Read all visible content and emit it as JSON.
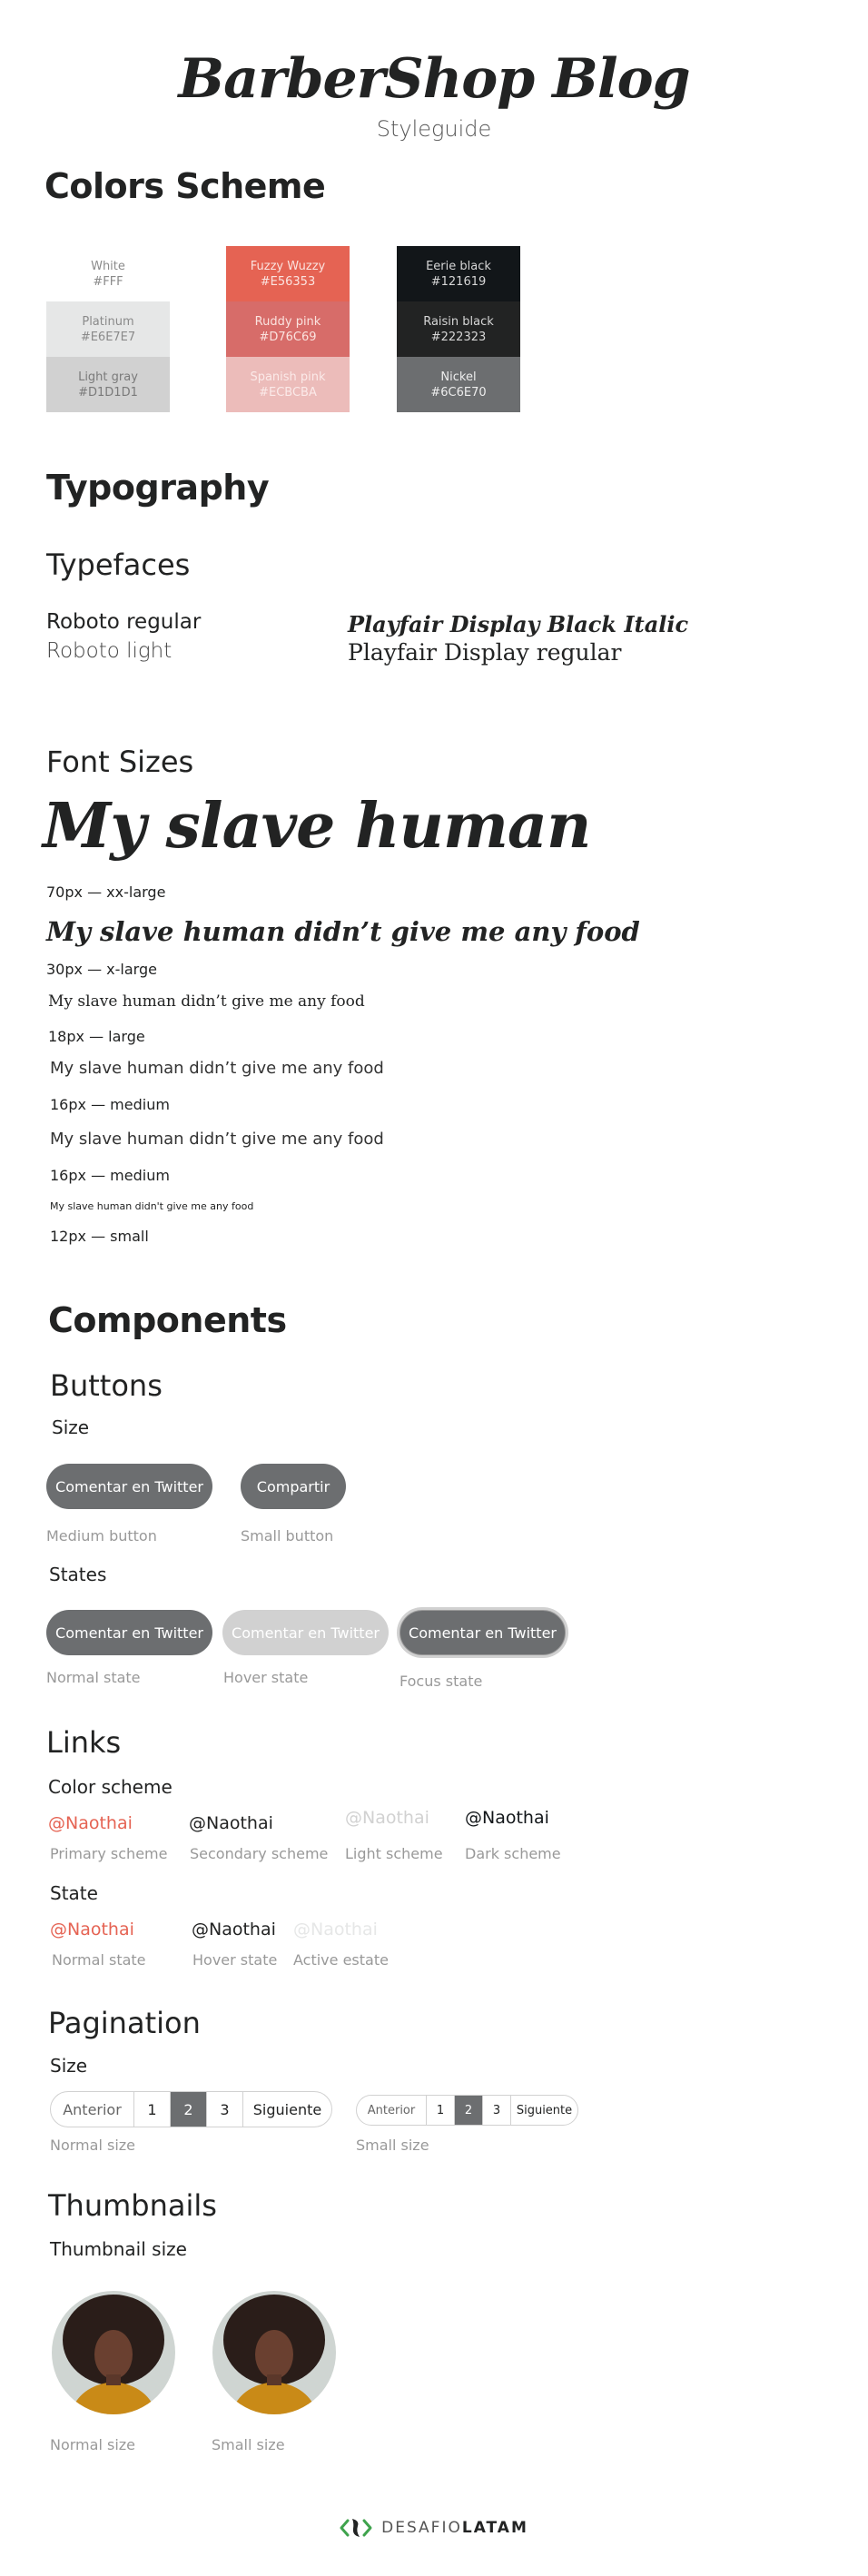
{
  "header": {
    "title": "BarberShop Blog",
    "subtitle": "Styleguide"
  },
  "colors": {
    "heading": "Colors Scheme",
    "columns": [
      [
        {
          "name": "White",
          "hex": "#FFF",
          "bg": "#ffffff",
          "fg": "#8a8a8a"
        },
        {
          "name": "Platinum",
          "hex": "#E6E7E7",
          "bg": "#e6e7e7",
          "fg": "#8a8a8a"
        },
        {
          "name": "Light gray",
          "hex": "#D1D1D1",
          "bg": "#d1d1d1",
          "fg": "#7a7a7a"
        }
      ],
      [
        {
          "name": "Fuzzy Wuzzy",
          "hex": "#E56353",
          "bg": "#e56353",
          "fg": "#fbe3df"
        },
        {
          "name": "Ruddy pink",
          "hex": "#D76C69",
          "bg": "#d76c69",
          "fg": "#fbe3df"
        },
        {
          "name": "Spanish pink",
          "hex": "#ECBCBA",
          "bg": "#ecbcba",
          "fg": "#fbeae9"
        }
      ],
      [
        {
          "name": "Eerie black",
          "hex": "#121619",
          "bg": "#121619",
          "fg": "#d6d6d6"
        },
        {
          "name": "Raisin black",
          "hex": "#222323",
          "bg": "#222323",
          "fg": "#d6d6d6"
        },
        {
          "name": "Nickel",
          "hex": "#6C6E70",
          "bg": "#6c6e70",
          "fg": "#ededed"
        }
      ]
    ]
  },
  "typography": {
    "heading": "Typography",
    "typefaces_heading": "Typefaces",
    "roboto_regular": "Roboto regular",
    "roboto_light": "Roboto light",
    "playfair_black_italic": "Playfair Display Black Italic",
    "playfair_regular": "Playfair Display regular"
  },
  "font_sizes": {
    "heading": "Font Sizes",
    "xxl_sample": "My slave human",
    "xxl_label": "70px — xx-large",
    "xl_sample": "My slave human didn’t give me any food",
    "xl_label": "30px — x-large",
    "l_sample": "My slave human didn’t give me any food",
    "l_label": "18px — large",
    "m1_sample": "My slave human didn’t give me any food",
    "m1_label": "16px — medium",
    "m2_sample": "My slave human didn’t give me any food",
    "m2_label": "16px — medium",
    "s_sample": "My slave human didn't give me any food",
    "s_label": "12px — small"
  },
  "components": {
    "heading": "Components",
    "buttons": {
      "heading": "Buttons",
      "size_label": "Size",
      "medium_button": "Comentar en Twitter",
      "small_button": "Compartir",
      "medium_caption": "Medium button",
      "small_caption": "Small button",
      "states_label": "States",
      "normal_button": "Comentar en Twitter",
      "hover_button": "Comentar en Twitter",
      "focus_button": "Comentar en Twitter",
      "normal_caption": "Normal state",
      "hover_caption": "Hover state",
      "focus_caption": "Focus state"
    },
    "links": {
      "heading": "Links",
      "color_scheme_label": "Color scheme",
      "scheme": [
        {
          "text": "@Naothai",
          "caption": "Primary scheme",
          "color": "#e56353"
        },
        {
          "text": "@Naothai",
          "caption": "Secondary scheme",
          "color": "#222323"
        },
        {
          "text": "@Naothai",
          "caption": "Light scheme",
          "color": "#d1d1d1"
        },
        {
          "text": "@Naothai",
          "caption": "Dark scheme",
          "color": "#121619"
        }
      ],
      "state_label": "State",
      "states": [
        {
          "text": "@Naothai",
          "caption": "Normal state",
          "color": "#e56353"
        },
        {
          "text": "@Naothai",
          "caption": "Hover state",
          "color": "#222323"
        },
        {
          "text": "@Naothai",
          "caption": "Active estate",
          "color": "#e6e7e7"
        }
      ]
    },
    "pagination": {
      "heading": "Pagination",
      "size_label": "Size",
      "prev": "Anterior",
      "pages": [
        "1",
        "2",
        "3"
      ],
      "active_page": "2",
      "next": "Siguiente",
      "normal_caption": "Normal size",
      "small_caption": "Small size"
    },
    "thumbnails": {
      "heading": "Thumbnails",
      "size_label": "Thumbnail size",
      "normal_caption": "Normal size",
      "small_caption": "Small size"
    }
  },
  "footer": {
    "logo_light": "DESAFIO",
    "logo_bold": "LATAM"
  }
}
